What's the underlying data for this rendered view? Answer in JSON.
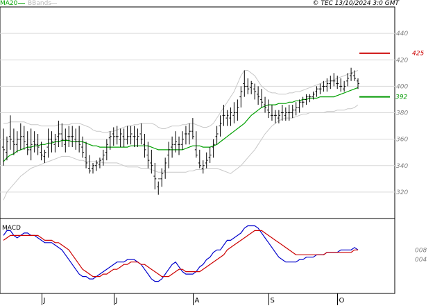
{
  "header": {
    "legend_ma": "MA20",
    "legend_bbands": "BBands",
    "copyright": "© TEC 13/10/2024 3:0 GMT"
  },
  "colors": {
    "price": "#000000",
    "ma": "#00a000",
    "bands": "#c8c8c8",
    "macd": "#0000cc",
    "signal": "#cc0000",
    "target_line": "#cc0000",
    "support_line": "#009900",
    "grid": "#d9d9d9",
    "axis_text": "#808080"
  },
  "price_panel": {
    "ylim": [
      300,
      460
    ],
    "ticks": [
      320,
      340,
      360,
      380,
      400,
      420,
      440
    ],
    "tick_labels": [
      "320",
      "340",
      "360",
      "380",
      "400",
      "420",
      "440"
    ],
    "lines": [
      {
        "value": 425,
        "label": "425",
        "color": "#cc0000"
      },
      {
        "value": 392,
        "label": "392",
        "color": "#009900"
      }
    ]
  },
  "macd_panel": {
    "title": "MACD",
    "ylim": [
      -10,
      21
    ],
    "ticks": [
      4,
      8
    ],
    "tick_labels": [
      "004",
      "008"
    ]
  },
  "x_axis": {
    "labels": [
      {
        "label": "J",
        "index": 11
      },
      {
        "label": "J",
        "index": 32
      },
      {
        "label": "A",
        "index": 55
      },
      {
        "label": "S",
        "index": 77
      },
      {
        "label": "O",
        "index": 97
      }
    ]
  },
  "chart_data": {
    "type": "bar",
    "x": [
      0,
      1,
      2,
      3,
      4,
      5,
      6,
      7,
      8,
      9,
      10,
      11,
      12,
      13,
      14,
      15,
      16,
      17,
      18,
      19,
      20,
      21,
      22,
      23,
      24,
      25,
      26,
      27,
      28,
      29,
      30,
      31,
      32,
      33,
      34,
      35,
      36,
      37,
      38,
      39,
      40,
      41,
      42,
      43,
      44,
      45,
      46,
      47,
      48,
      49,
      50,
      51,
      52,
      53,
      54,
      55,
      56,
      57,
      58,
      59,
      60,
      61,
      62,
      63,
      64,
      65,
      66,
      67,
      68,
      69,
      70,
      71,
      72,
      73,
      74,
      75,
      76,
      77,
      78,
      79,
      80,
      81,
      82,
      83,
      84,
      85,
      86,
      87,
      88,
      89,
      90,
      91,
      92,
      93,
      94,
      95,
      96,
      97,
      98,
      99,
      100,
      101,
      102,
      103
    ],
    "series": [
      {
        "name": "Price",
        "kind": "ohlc",
        "high": [
          368,
          362,
          378,
          368,
          366,
          372,
          370,
          366,
          368,
          366,
          364,
          358,
          352,
          368,
          366,
          364,
          374,
          372,
          368,
          370,
          370,
          368,
          370,
          362,
          358,
          348,
          342,
          344,
          346,
          352,
          360,
          366,
          369,
          370,
          368,
          368,
          370,
          370,
          370,
          368,
          372,
          364,
          358,
          352,
          342,
          328,
          338,
          346,
          358,
          362,
          366,
          362,
          366,
          370,
          372,
          376,
          366,
          352,
          344,
          350,
          354,
          360,
          370,
          378,
          386,
          382,
          384,
          388,
          390,
          400,
          412,
          406,
          404,
          402,
          400,
          398,
          392,
          390,
          386,
          382,
          382,
          386,
          384,
          386,
          386,
          388,
          390,
          392,
          394,
          394,
          396,
          400,
          402,
          404,
          406,
          408,
          410,
          408,
          406,
          404,
          410,
          414,
          412,
          406
        ],
        "low": [
          340,
          344,
          352,
          348,
          350,
          352,
          352,
          348,
          344,
          350,
          348,
          344,
          342,
          346,
          350,
          350,
          354,
          354,
          350,
          354,
          354,
          352,
          350,
          346,
          338,
          334,
          334,
          336,
          338,
          340,
          344,
          352,
          355,
          356,
          354,
          354,
          356,
          356,
          354,
          354,
          356,
          346,
          338,
          334,
          322,
          318,
          324,
          330,
          338,
          346,
          350,
          348,
          352,
          356,
          356,
          360,
          346,
          338,
          334,
          338,
          342,
          346,
          356,
          362,
          370,
          370,
          370,
          372,
          374,
          384,
          392,
          394,
          394,
          390,
          386,
          384,
          380,
          376,
          374,
          372,
          372,
          374,
          374,
          374,
          376,
          378,
          380,
          384,
          386,
          388,
          390,
          392,
          394,
          396,
          396,
          398,
          400,
          398,
          396,
          396,
          400,
          404,
          404,
          398
        ],
        "open": [
          354,
          350,
          362,
          358,
          356,
          360,
          362,
          356,
          352,
          358,
          356,
          350,
          347,
          354,
          360,
          356,
          362,
          364,
          356,
          362,
          362,
          360,
          358,
          354,
          346,
          338,
          338,
          340,
          341,
          345,
          350,
          361,
          364,
          362,
          360,
          362,
          360,
          362,
          362,
          360,
          364,
          356,
          348,
          342,
          332,
          324,
          330,
          336,
          348,
          354,
          356,
          356,
          356,
          364,
          364,
          366,
          352,
          342,
          338,
          342,
          346,
          354,
          362,
          370,
          378,
          376,
          376,
          378,
          380,
          392,
          402,
          400,
          399,
          398,
          394,
          390,
          386,
          382,
          378,
          378,
          376,
          380,
          378,
          380,
          380,
          382,
          384,
          388,
          390,
          392,
          392,
          396,
          398,
          400,
          400,
          402,
          404,
          402,
          400,
          398,
          404,
          408,
          408,
          404
        ],
        "close": [
          352,
          358,
          360,
          356,
          360,
          362,
          358,
          352,
          356,
          356,
          354,
          348,
          350,
          360,
          358,
          360,
          364,
          360,
          360,
          362,
          362,
          358,
          356,
          350,
          342,
          336,
          340,
          342,
          344,
          348,
          356,
          362,
          362,
          362,
          364,
          360,
          362,
          364,
          362,
          362,
          360,
          352,
          344,
          340,
          330,
          330,
          334,
          342,
          352,
          356,
          358,
          356,
          360,
          364,
          366,
          362,
          348,
          340,
          340,
          344,
          348,
          356,
          364,
          372,
          378,
          378,
          380,
          380,
          384,
          396,
          400,
          398,
          402,
          396,
          392,
          388,
          384,
          380,
          378,
          378,
          378,
          380,
          380,
          380,
          382,
          384,
          388,
          388,
          392,
          392,
          394,
          398,
          398,
          400,
          402,
          404,
          404,
          402,
          400,
          400,
          406,
          410,
          406,
          402
        ]
      },
      {
        "name": "MA20",
        "kind": "line",
        "values": [
          343,
          346,
          348,
          349,
          351,
          352,
          353,
          354,
          354,
          355,
          355,
          356,
          356,
          357,
          357,
          358,
          358,
          359,
          359,
          359,
          358,
          358,
          358,
          358,
          357,
          356,
          355,
          355,
          354,
          354,
          354,
          354,
          354,
          354,
          354,
          354,
          354,
          355,
          355,
          355,
          355,
          355,
          355,
          354,
          353,
          352,
          352,
          352,
          352,
          352,
          352,
          352,
          352,
          353,
          354,
          355,
          355,
          355,
          354,
          354,
          354,
          355,
          356,
          358,
          360,
          362,
          364,
          366,
          368,
          370,
          372,
          375,
          378,
          380,
          382,
          384,
          385,
          386,
          386,
          386,
          387,
          387,
          387,
          388,
          388,
          389,
          389,
          390,
          390,
          391,
          391,
          391,
          392,
          392,
          392,
          392,
          392,
          393,
          394,
          395,
          396,
          397,
          398,
          399
        ]
      },
      {
        "name": "BBands upper",
        "kind": "line",
        "values": [
          372,
          372,
          373,
          373,
          373,
          373,
          373,
          372,
          371,
          371,
          371,
          370,
          370,
          370,
          370,
          370,
          371,
          371,
          371,
          371,
          372,
          372,
          372,
          371,
          370,
          369,
          367,
          366,
          366,
          365,
          365,
          366,
          366,
          367,
          368,
          369,
          370,
          370,
          371,
          371,
          372,
          372,
          372,
          372,
          371,
          369,
          368,
          368,
          369,
          370,
          370,
          370,
          371,
          371,
          372,
          372,
          371,
          370,
          369,
          369,
          370,
          372,
          376,
          380,
          384,
          388,
          392,
          396,
          402,
          408,
          412,
          412,
          410,
          408,
          404,
          400,
          398,
          396,
          395,
          395,
          394,
          394,
          394,
          395,
          395,
          396,
          396,
          397,
          398,
          399,
          400,
          401,
          402,
          403,
          404,
          404,
          405,
          406,
          407,
          408,
          409,
          410,
          411,
          412
        ]
      },
      {
        "name": "BBands lower",
        "kind": "line",
        "values": [
          314,
          320,
          323,
          326,
          329,
          332,
          334,
          336,
          338,
          339,
          340,
          341,
          342,
          343,
          344,
          345,
          346,
          347,
          347,
          347,
          346,
          345,
          344,
          344,
          343,
          343,
          343,
          343,
          343,
          342,
          342,
          342,
          342,
          342,
          341,
          340,
          339,
          339,
          339,
          339,
          338,
          338,
          338,
          337,
          336,
          335,
          335,
          335,
          335,
          335,
          335,
          335,
          335,
          335,
          336,
          336,
          337,
          337,
          337,
          338,
          338,
          338,
          338,
          337,
          336,
          335,
          334,
          336,
          338,
          340,
          343,
          346,
          349,
          352,
          356,
          360,
          364,
          367,
          370,
          372,
          374,
          375,
          376,
          376,
          376,
          377,
          378,
          379,
          379,
          380,
          380,
          380,
          380,
          380,
          381,
          381,
          381,
          382,
          382,
          382,
          383,
          383,
          384,
          386
        ]
      },
      {
        "name": "MACD",
        "kind": "line",
        "panel": "macd",
        "values": [
          14,
          16,
          16,
          14,
          13,
          14,
          15,
          15,
          14,
          14,
          13,
          12,
          11,
          11,
          11,
          10,
          9,
          8,
          6,
          4,
          2,
          0,
          -2,
          -3,
          -3,
          -4,
          -4,
          -3,
          -2,
          -1,
          0,
          1,
          2,
          3,
          3,
          3,
          4,
          4,
          4,
          3,
          2,
          0,
          -2,
          -4,
          -5,
          -5,
          -4,
          -2,
          0,
          2,
          3,
          1,
          -1,
          -2,
          -2,
          -2,
          -1,
          1,
          2,
          4,
          5,
          7,
          8,
          8,
          10,
          12,
          12,
          13,
          14,
          15,
          17,
          18,
          18,
          18,
          17,
          15,
          13,
          11,
          9,
          7,
          5,
          4,
          3,
          3,
          3,
          3,
          4,
          4,
          5,
          5,
          5,
          6,
          6,
          6,
          7,
          7,
          7,
          7,
          8,
          8,
          8,
          8,
          9,
          8
        ]
      },
      {
        "name": "Signal",
        "kind": "line",
        "panel": "macd",
        "values": [
          12,
          13,
          14,
          14,
          14,
          14,
          14,
          14,
          14,
          14,
          14,
          13,
          12,
          12,
          12,
          11,
          11,
          10,
          9,
          8,
          6,
          4,
          2,
          0,
          -1,
          -2,
          -3,
          -3,
          -3,
          -2,
          -2,
          -1,
          0,
          0,
          1,
          2,
          2,
          3,
          3,
          3,
          2,
          2,
          1,
          0,
          -1,
          -2,
          -3,
          -3,
          -3,
          -2,
          -1,
          0,
          0,
          -1,
          -1,
          -1,
          -1,
          -1,
          0,
          1,
          2,
          3,
          4,
          5,
          6,
          8,
          9,
          10,
          11,
          12,
          13,
          14,
          15,
          16,
          16,
          16,
          15,
          14,
          13,
          12,
          11,
          10,
          9,
          8,
          7,
          6,
          6,
          6,
          6,
          6,
          6,
          6,
          6,
          6,
          7,
          7,
          7,
          7,
          7,
          7,
          7,
          7,
          8,
          8
        ]
      }
    ]
  }
}
